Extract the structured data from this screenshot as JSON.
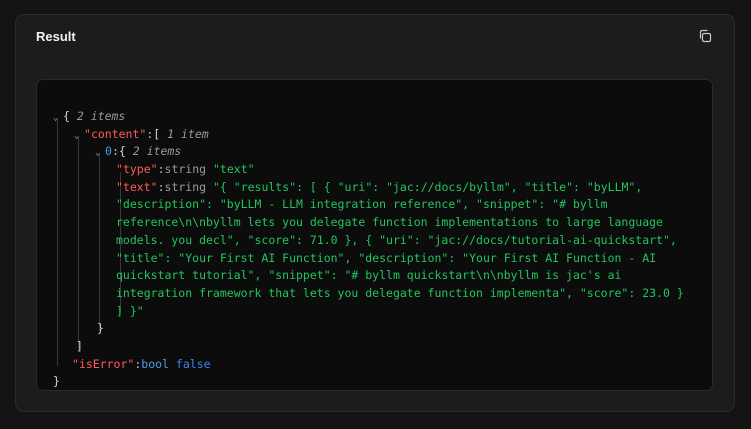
{
  "panel": {
    "title": "Result",
    "copy_icon": "copy-icon"
  },
  "json_view": {
    "root_count": "2 items",
    "content_key": "content",
    "content_count": "1 item",
    "item_index": "0",
    "item_count": "2 items",
    "type_key": "type",
    "type_type": "string",
    "type_value": "\"text\"",
    "text_key": "text",
    "text_type": "string",
    "text_lines": [
      "\"{ \"results\": [ { \"uri\": \"jac://docs/byllm\", \"title\": \"byLLM\",",
      "\"description\": \"byLLM - LLM integration reference\", \"snippet\": \"# byllm",
      "reference\\n\\nbyllm lets you delegate function implementations to large language",
      "models. you decl\", \"score\": 71.0 }, { \"uri\": \"jac://docs/tutorial-ai-quickstart\",",
      "\"title\": \"Your First AI Function\", \"description\": \"Your First AI Function - AI",
      "quickstart tutorial\", \"snippet\": \"# byllm quickstart\\n\\nbyllm is jac's ai",
      "integration framework that lets you delegate function implementa\", \"score\": 23.0 }",
      "] }\""
    ],
    "iserror_key": "isError",
    "iserror_type": "bool",
    "iserror_value": "false"
  }
}
